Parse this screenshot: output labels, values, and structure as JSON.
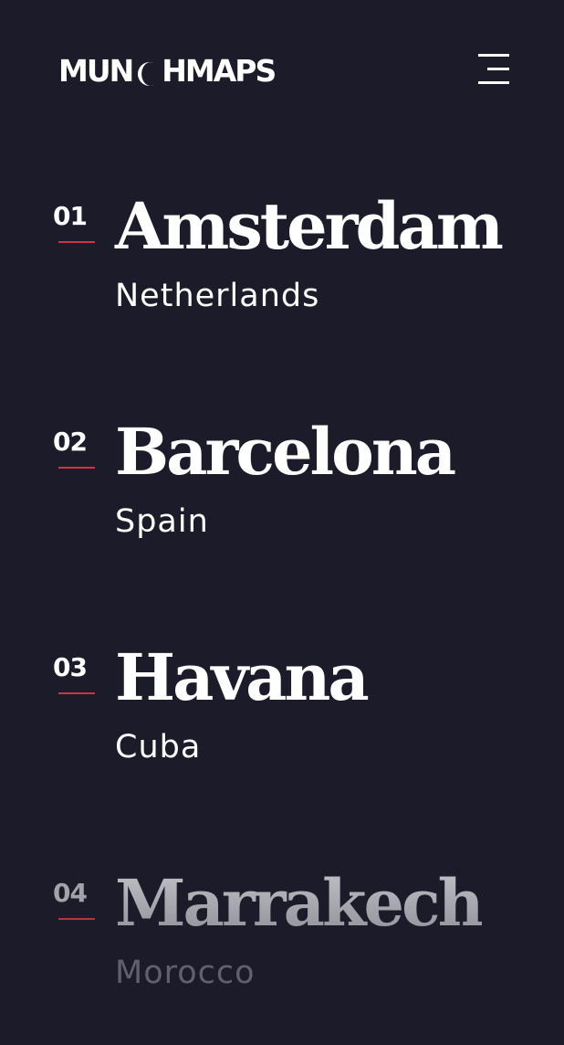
{
  "header": {
    "logo_left": "MUN",
    "logo_right": "HMAPS",
    "logo_mark_icon": "crescent-c-icon",
    "menu_icon": "hamburger-menu-icon"
  },
  "cities": [
    {
      "index": "01",
      "name": "Amsterdam",
      "country": "Netherlands"
    },
    {
      "index": "02",
      "name": "Barcelona",
      "country": "Spain"
    },
    {
      "index": "03",
      "name": "Havana",
      "country": "Cuba"
    },
    {
      "index": "04",
      "name": "Marrakech",
      "country": "Morocco"
    }
  ],
  "colors": {
    "background": "#1b1b2a",
    "accent": "#d6313e",
    "text": "#ffffff",
    "faded_text": "#60606e"
  }
}
